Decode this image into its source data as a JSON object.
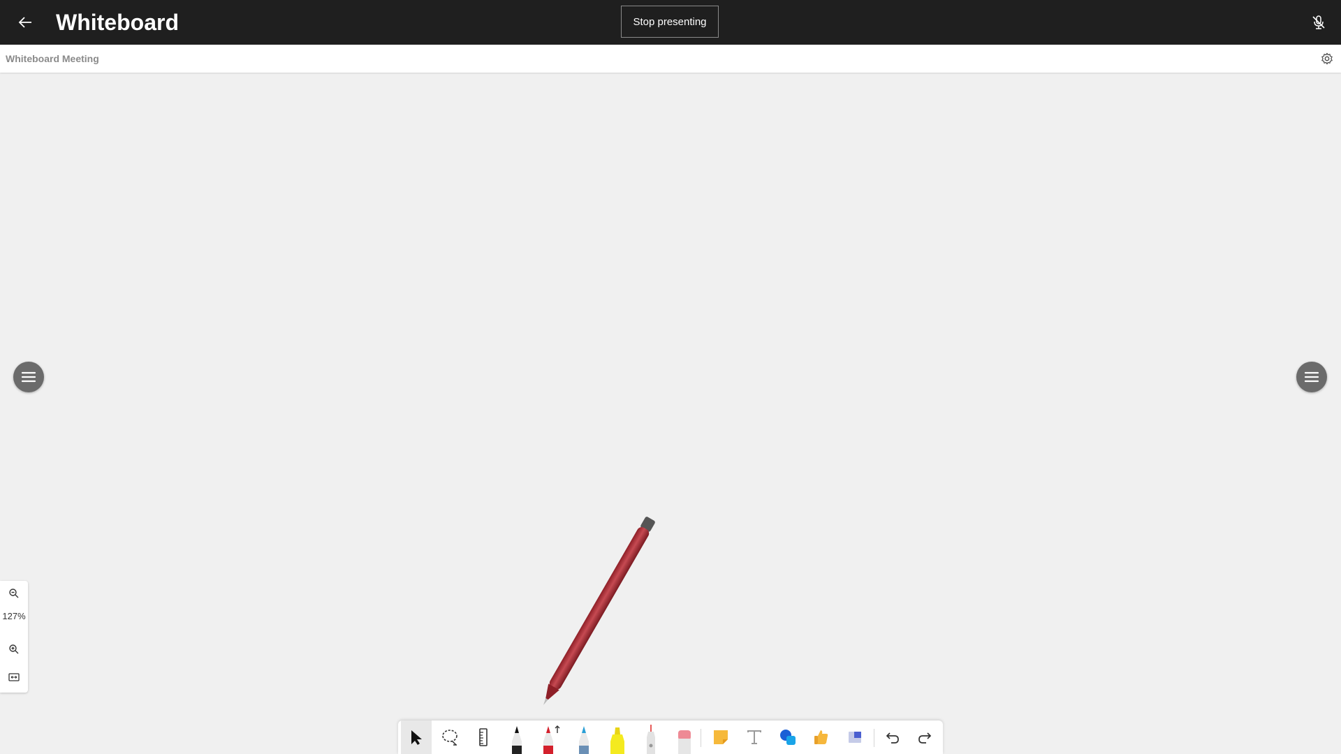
{
  "app": {
    "title": "Whiteboard",
    "stop_label": "Stop presenting",
    "meeting_title": "Whiteboard Meeting"
  },
  "zoom": {
    "level": "127%"
  },
  "icons": {
    "back": "arrow-left-icon",
    "mic": "mic-off-icon",
    "settings": "gear-icon",
    "menu": "hamburger-menu-icon",
    "zoom_out": "zoom-out-icon",
    "zoom_in": "zoom-in-icon",
    "fit": "fit-screen-icon"
  },
  "toolbar": {
    "tools": [
      "select",
      "lasso",
      "ruler",
      "black-pen",
      "red-pen",
      "blue-pen",
      "highlighter",
      "laser-pointer",
      "eraser",
      "sticky-note",
      "text",
      "shapes",
      "reactions",
      "templates",
      "undo",
      "redo"
    ],
    "active": "select"
  },
  "colors": {
    "topbar": "#1f1f1f",
    "canvas": "#f0f0f0",
    "pen_red": "#c0393f",
    "highlighter_yellow": "#f4e61a",
    "shape_blue": "#1a73e8"
  }
}
